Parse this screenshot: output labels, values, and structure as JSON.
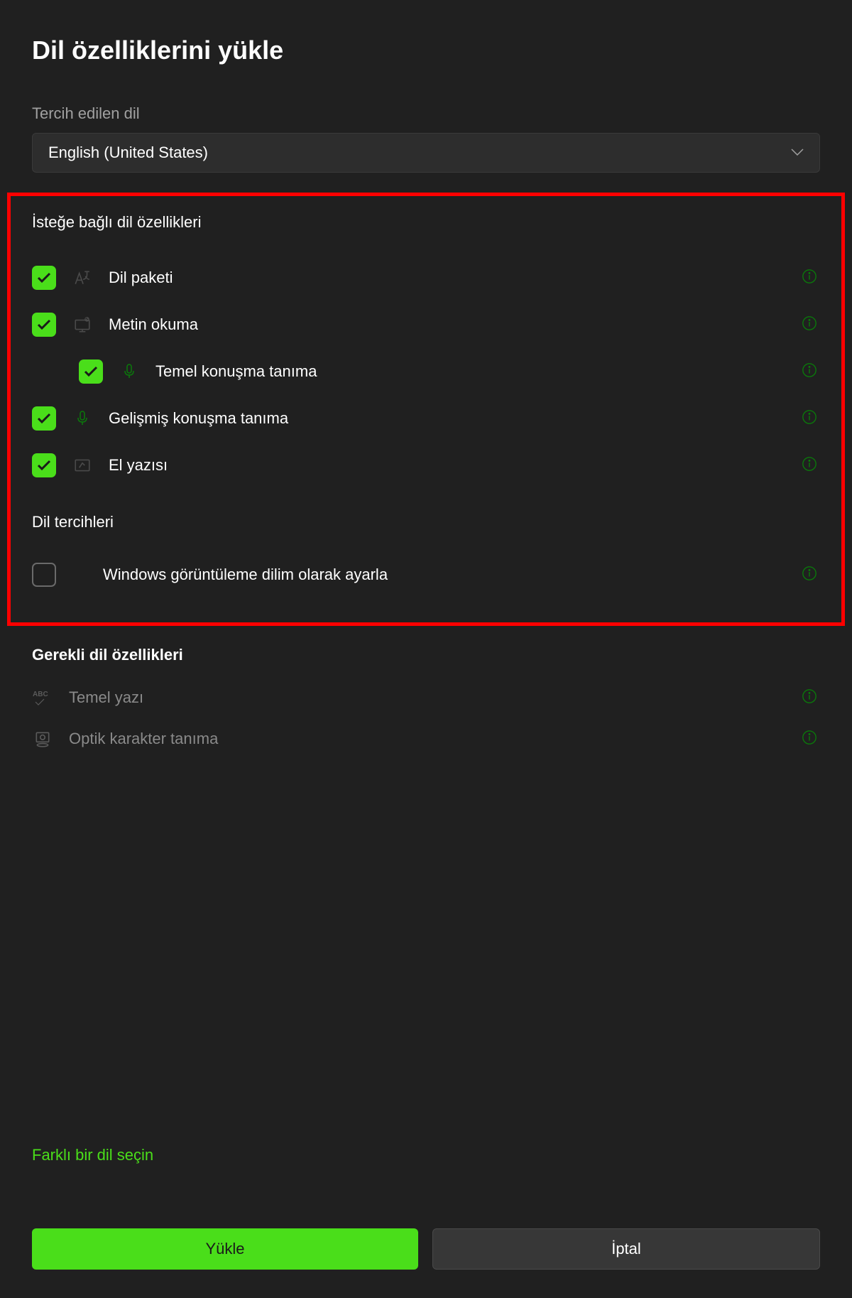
{
  "title": "Dil özelliklerini yükle",
  "preferred_language": {
    "label": "Tercih edilen dil",
    "selected": "English (United States)"
  },
  "optional_section": {
    "title": "İsteğe bağlı dil özellikleri",
    "features": [
      {
        "label": "Dil paketi",
        "checked": true,
        "indented": false
      },
      {
        "label": "Metin okuma",
        "checked": true,
        "indented": false
      },
      {
        "label": "Temel konuşma tanıma",
        "checked": true,
        "indented": true
      },
      {
        "label": "Gelişmiş konuşma tanıma",
        "checked": true,
        "indented": false
      },
      {
        "label": "El yazısı",
        "checked": true,
        "indented": false
      }
    ]
  },
  "preferences_section": {
    "title": "Dil tercihleri",
    "items": [
      {
        "label": "Windows görüntüleme dilim olarak ayarla",
        "checked": false
      }
    ]
  },
  "required_section": {
    "title": "Gerekli dil özellikleri",
    "items": [
      {
        "label": "Temel yazı"
      },
      {
        "label": "Optik karakter tanıma"
      }
    ]
  },
  "link": "Farklı bir dil seçin",
  "buttons": {
    "install": "Yükle",
    "cancel": "İptal"
  }
}
